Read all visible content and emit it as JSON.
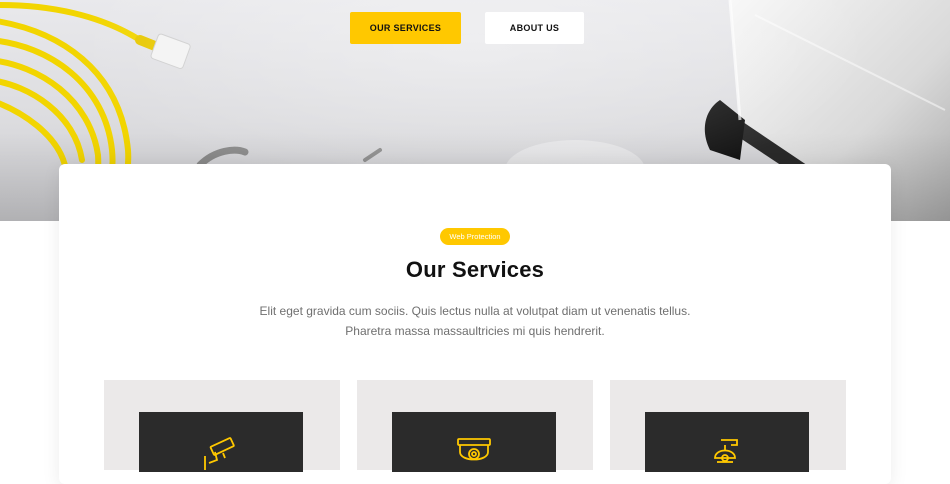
{
  "hero": {
    "buttons": {
      "services_label": "OUR SERVICES",
      "about_label": "ABOUT US"
    }
  },
  "section": {
    "badge": "Web Protection",
    "title": "Our Services",
    "subtitle_line1": "Elit eget gravida cum sociis. Quis lectus nulla at volutpat diam ut venenatis tellus.",
    "subtitle_line2": "Pharetra massa massaultricies mi quis hendrerit."
  },
  "services": [
    {
      "icon": "security-camera-icon"
    },
    {
      "icon": "dome-camera-icon"
    },
    {
      "icon": "ptz-camera-icon"
    }
  ],
  "colors": {
    "accent": "#ffc800",
    "card_bg": "#ebe9e9",
    "tile_bg": "#2b2b2b",
    "icon_stroke": "#ffc800"
  }
}
